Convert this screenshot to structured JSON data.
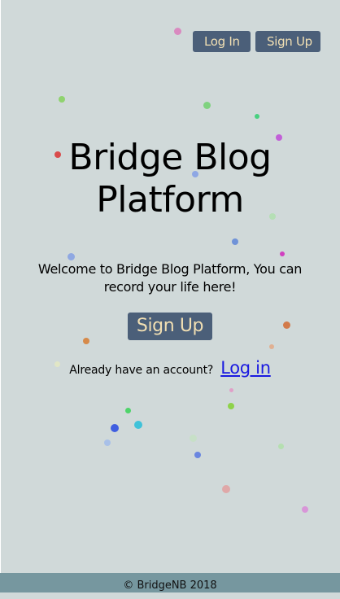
{
  "nav": {
    "login_label": "Log In",
    "signup_label": "Sign Up"
  },
  "hero": {
    "title_line1": "Bridge Blog",
    "title_line2": "Platform",
    "welcome_text": "Welcome to Bridge Blog Platform, You can record your life here!",
    "signup_label": "Sign Up",
    "login_prompt": "Already have an account?",
    "login_link": "Log in"
  },
  "footer": {
    "copyright": "© BridgeNB 2018"
  },
  "colors": {
    "background": "#d0d9d9",
    "button_bg": "#4b5f79",
    "button_text": "#f1dfb3",
    "footer_bg": "#76979f",
    "link": "#1a1ae0"
  }
}
